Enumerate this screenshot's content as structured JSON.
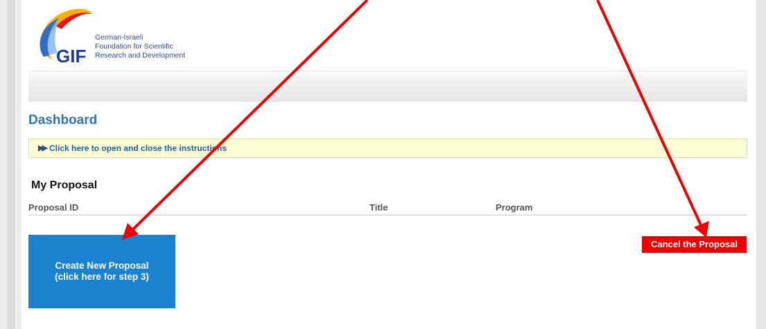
{
  "logo": {
    "acronym": "GIF",
    "lines": [
      "German-Israeli",
      "Foundation for Scientific",
      "Research and Development"
    ]
  },
  "page": {
    "title": "Dashboard"
  },
  "instructions": {
    "icon": "fast-forward-icon",
    "label": "Click here to open and close the instructions"
  },
  "proposals": {
    "heading": "My Proposal",
    "columns": [
      "Proposal ID",
      "Title",
      "Program"
    ]
  },
  "buttons": {
    "create_line1": "Create New Proposal",
    "create_line2": "(click here for step 3)",
    "cancel": "Cancel the Proposal"
  },
  "colors": {
    "accent_blue": "#1a82cf",
    "heading_blue": "#2a77b7",
    "cancel_red": "#ee0000",
    "annotation_arrow": "#ee0000",
    "instructions_bg": "#ffffd5"
  }
}
